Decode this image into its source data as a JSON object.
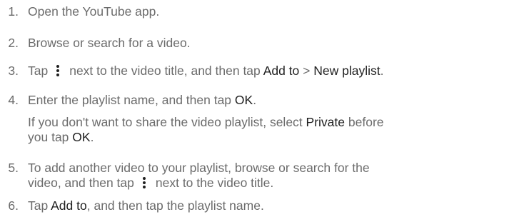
{
  "steps": [
    {
      "number": "1.",
      "parts": [
        "Open the YouTube app."
      ]
    },
    {
      "number": "2.",
      "parts": [
        "Browse or search for a video."
      ]
    },
    {
      "number": "3.",
      "before_icon": "Tap",
      "icon": "more-options-icon",
      "after_icon": "next to the video title, and then tap",
      "hl1": "Add to",
      "sep": ">",
      "hl2": "New playlist",
      "end": "."
    },
    {
      "number": "4.",
      "a": "Enter the playlist name, and then tap",
      "hl": "OK",
      "end": ".",
      "note": {
        "line1_a": "If you don't want to share the video playlist, select",
        "line1_hl": "Private",
        "line1_b": "before",
        "line2_a": "you tap",
        "line2_hl": "OK",
        "line2_end": "."
      }
    },
    {
      "number": "5.",
      "line1": "To add another video to your playlist, browse or search for the",
      "line2_a": "video, and then tap",
      "icon": "more-options-icon",
      "line2_b": "next to the video title."
    },
    {
      "number": "6.",
      "a": "Tap",
      "hl": "Add to",
      "b": ", and then tap the playlist name."
    }
  ],
  "colors": {
    "body_text": "#6b6b6b",
    "highlight_text": "#1f1f1f"
  }
}
